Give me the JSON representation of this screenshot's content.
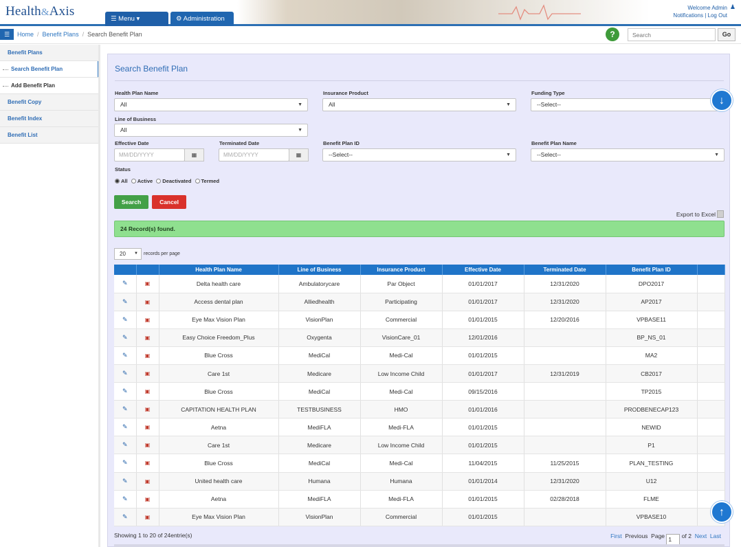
{
  "header": {
    "logo_left": "Health",
    "logo_mid": "&",
    "logo_right": "Axis",
    "menu_tab": "☰ Menu ▾",
    "admin_tab": "⚙ Administration",
    "welcome": "Welcome Admin",
    "notifications": "Notifications",
    "logout": "Log Out"
  },
  "breadcrumb": {
    "home": "Home",
    "benefit_plans": "Benefit Plans",
    "current": "Search Benefit Plan"
  },
  "search": {
    "placeholder": "Search",
    "go_label": "Go"
  },
  "sidebar": {
    "items": [
      {
        "label": "Benefit Plans"
      },
      {
        "label": "Search Benefit Plan"
      },
      {
        "label": "Add Benefit Plan"
      },
      {
        "label": "Benefit Copy"
      },
      {
        "label": "Benefit Index"
      },
      {
        "label": "Benefit List"
      }
    ]
  },
  "form": {
    "title": "Search Benefit Plan",
    "health_plan_name": {
      "label": "Health Plan Name",
      "value": "All"
    },
    "insurance_product": {
      "label": "Insurance Product",
      "value": "All"
    },
    "funding_type": {
      "label": "Funding Type",
      "value": "--Select--"
    },
    "line_of_business": {
      "label": "Line of Business",
      "value": "All"
    },
    "effective_date": {
      "label": "Effective Date",
      "placeholder": "MM/DD/YYYY"
    },
    "terminated_date": {
      "label": "Terminated Date",
      "placeholder": "MM/DD/YYYY"
    },
    "benefit_plan_id": {
      "label": "Benefit Plan ID",
      "value": "--Select--"
    },
    "benefit_plan_name": {
      "label": "Benefit Plan Name",
      "value": "--Select--"
    },
    "status": {
      "label": "Status",
      "options": [
        "All",
        "Active",
        "Deactivated",
        "Termed"
      ],
      "selected": "All"
    },
    "search_button": "Search",
    "cancel_button": "Cancel"
  },
  "results": {
    "export_label": "Export to Excel",
    "records_found": "24 Record(s) found.",
    "per_page_value": "20",
    "per_page_label": "records per page",
    "columns": [
      "",
      "",
      "Health Plan Name",
      "Line of Business",
      "Insurance Product",
      "Effective Date",
      "Terminated Date",
      "Benefit Plan ID",
      ""
    ],
    "rows": [
      [
        "Delta health care",
        "Ambulatorycare",
        "Par Object",
        "01/01/2017",
        "12/31/2020",
        "DPO2017"
      ],
      [
        "Access dental plan",
        "Alliedhealth",
        "Participating",
        "01/01/2017",
        "12/31/2020",
        "AP2017"
      ],
      [
        "Eye Max Vision Plan",
        "VisionPlan",
        "Commercial",
        "01/01/2015",
        "12/20/2016",
        "VPBASE11"
      ],
      [
        "Easy Choice Freedom_Plus",
        "Oxygenta",
        "VisionCare_01",
        "12/01/2016",
        "",
        "BP_NS_01"
      ],
      [
        "Blue Cross",
        "MediCal",
        "Medi-Cal",
        "01/01/2015",
        "",
        "MA2"
      ],
      [
        "Care 1st",
        "Medicare",
        "Low Income Child",
        "01/01/2017",
        "12/31/2019",
        "CB2017"
      ],
      [
        "Blue Cross",
        "MediCal",
        "Medi-Cal",
        "09/15/2016",
        "",
        "TP2015"
      ],
      [
        "CAPITATION HEALTH PLAN",
        "TESTBUSINESS",
        "HMO",
        "01/01/2016",
        "",
        "PRODBENECAP123"
      ],
      [
        "Aetna",
        "MediFLA",
        "Medi-FLA",
        "01/01/2015",
        "",
        "NEWID"
      ],
      [
        "Care 1st",
        "Medicare",
        "Low Income Child",
        "01/01/2015",
        "",
        "P1"
      ],
      [
        "Blue Cross",
        "MediCal",
        "Medi-Cal",
        "11/04/2015",
        "11/25/2015",
        "PLAN_TESTING"
      ],
      [
        "United health care",
        "Humana",
        "Humana",
        "01/01/2014",
        "12/31/2020",
        "U12"
      ],
      [
        "Aetna",
        "MediFLA",
        "Medi-FLA",
        "01/01/2015",
        "02/28/2018",
        "FLME"
      ],
      [
        "Eye Max Vision Plan",
        "VisionPlan",
        "Commercial",
        "01/01/2015",
        "",
        "VPBASE10"
      ]
    ],
    "showing": "Showing 1 to 20 of 24entrie(s)",
    "pager": {
      "first": "First",
      "previous": "Previous",
      "page_label": "Page",
      "page_value": "1",
      "of": "of 2",
      "next": "Next",
      "last": "Last"
    }
  },
  "icons": {
    "edit": "pencil-icon",
    "delete": "trash-icon",
    "scroll_down": "arrow-down-icon",
    "scroll_up": "arrow-up-icon"
  },
  "colors": {
    "brand": "#2066b0",
    "table_header": "#1f74c8",
    "success_bar": "#8fe08f",
    "search_btn": "#43a047",
    "cancel_btn": "#d9312b",
    "panel_bg": "#e9e9fb"
  }
}
